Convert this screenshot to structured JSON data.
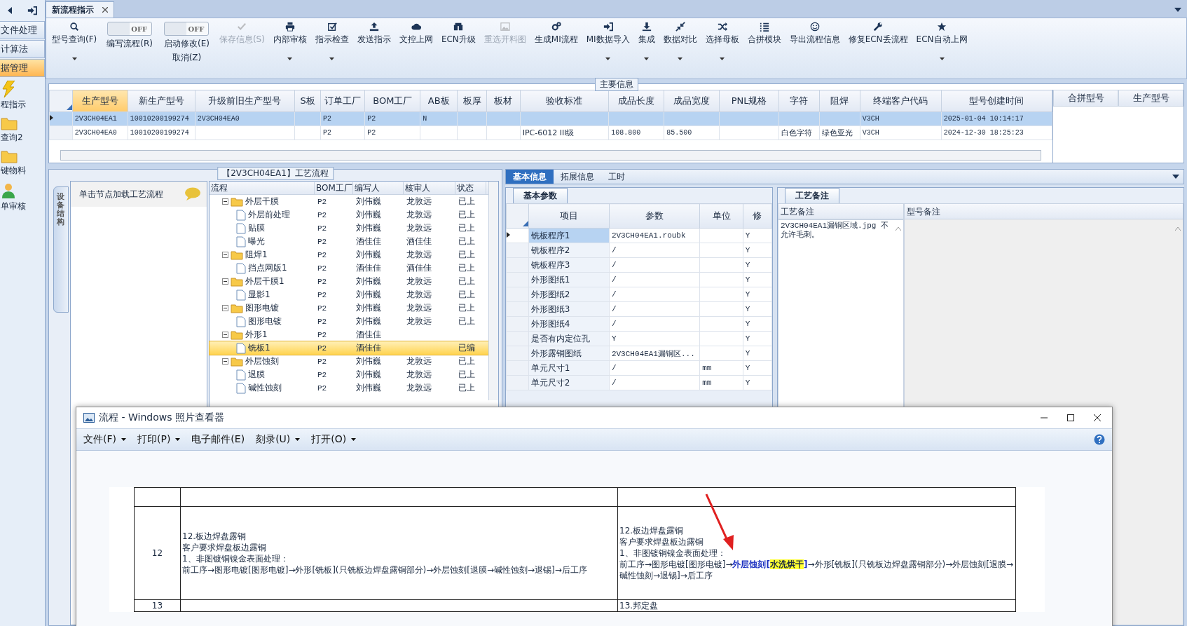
{
  "nav": {
    "items": [
      {
        "label": "文件处理",
        "selected": false
      },
      {
        "label": "计算法",
        "selected": false
      },
      {
        "label": "据管理",
        "selected": true
      }
    ],
    "shortcuts": [
      {
        "label": "程指示"
      },
      {
        "label": "查询2"
      },
      {
        "label": "键物料"
      },
      {
        "label": "单审核"
      }
    ]
  },
  "doc_tab": {
    "label": "新流程指示"
  },
  "ribbon": [
    {
      "kind": "button",
      "label": "型号查询(F)",
      "dropdown": true,
      "disabled": false
    },
    {
      "kind": "toggle",
      "switch_text": "OFF",
      "on": false,
      "lines": [
        "编写流程(R)"
      ]
    },
    {
      "kind": "toggle",
      "switch_text": "OFF",
      "on": false,
      "lines": [
        "启动修改(E)",
        "取消(Z)"
      ]
    },
    {
      "kind": "button",
      "label": "保存信息(S)",
      "dropdown": false,
      "disabled": true
    },
    {
      "kind": "button",
      "label": "内部审核",
      "dropdown": true,
      "disabled": false
    },
    {
      "kind": "button",
      "label": "指示检查",
      "dropdown": true,
      "disabled": false
    },
    {
      "kind": "button",
      "label": "发送指示",
      "dropdown": false,
      "disabled": false
    },
    {
      "kind": "button",
      "label": "文控上网",
      "dropdown": false,
      "disabled": false
    },
    {
      "kind": "button",
      "label": "ECN升级",
      "dropdown": false,
      "disabled": false
    },
    {
      "kind": "button",
      "label": "重选开料图",
      "dropdown": false,
      "disabled": true
    },
    {
      "kind": "button",
      "label": "生成MI流程",
      "dropdown": false,
      "disabled": false
    },
    {
      "kind": "button",
      "label": "MI数据导入",
      "dropdown": true,
      "disabled": false
    },
    {
      "kind": "button",
      "label": "集成",
      "dropdown": true,
      "disabled": false
    },
    {
      "kind": "button",
      "label": "数据对比",
      "dropdown": true,
      "disabled": false
    },
    {
      "kind": "button",
      "label": "选择母板",
      "dropdown": true,
      "disabled": false
    },
    {
      "kind": "button",
      "label": "合拼模块",
      "dropdown": false,
      "disabled": false
    },
    {
      "kind": "button",
      "label": "导出流程信息",
      "dropdown": false,
      "disabled": false
    },
    {
      "kind": "button",
      "label": "修复ECN丢流程",
      "dropdown": false,
      "disabled": false
    },
    {
      "kind": "button",
      "label": "ECN自动上网",
      "dropdown": true,
      "disabled": false
    }
  ],
  "main_info": {
    "legend": "主要信息",
    "columns": [
      "生产型号",
      "新生产型号",
      "升级前旧生产型号",
      "S板",
      "订单工厂",
      "BOM工厂",
      "AB板",
      "板厚",
      "板材",
      "验收标准",
      "成品长度",
      "成品宽度",
      "PNL规格",
      "字符",
      "阻焊",
      "终端客户代码",
      "型号创建时间"
    ],
    "rows": [
      {
        "selected": true,
        "cells": [
          "2V3CH04EA1",
          "10010200199274",
          "2V3CH04EA0",
          null,
          "P2",
          "P2",
          "N",
          null,
          null,
          null,
          null,
          null,
          null,
          null,
          null,
          "V3CH",
          "2025-01-04 10:14:17"
        ]
      },
      {
        "selected": false,
        "cells": [
          "2V3CH04EA0",
          "10010200199274",
          null,
          null,
          "P2",
          "P2",
          null,
          null,
          null,
          "IPC-6012 III级",
          "108.800",
          "85.500",
          null,
          "白色字符",
          "绿色亚光",
          "V3CH",
          "2024-12-30 18:25:23"
        ]
      }
    ],
    "side_columns": [
      "合拼型号",
      "生产型号"
    ]
  },
  "process": {
    "legend": "【2V3CH04EA1】工艺流程",
    "side_tab": "设备结构",
    "hint": "单击节点加载工艺流程",
    "columns": [
      "流程",
      "BOM工厂",
      "编写人",
      "核审人",
      "状态"
    ],
    "tree": [
      {
        "label": "外层干膜",
        "bom": "P2",
        "writer": "刘伟巍",
        "reviewer": "龙敦远",
        "status": "已上",
        "expanded": true,
        "selected": false,
        "children": [
          {
            "label": "外层前处理",
            "bom": "P2",
            "writer": "刘伟巍",
            "reviewer": "龙敦远",
            "status": "已上",
            "selected": false
          },
          {
            "label": "贴膜",
            "bom": "P2",
            "writer": "刘伟巍",
            "reviewer": "龙敦远",
            "status": "已上",
            "selected": false
          },
          {
            "label": "曝光",
            "bom": "P2",
            "writer": "酒佳佳",
            "reviewer": "酒佳佳",
            "status": "已上",
            "selected": false
          }
        ]
      },
      {
        "label": "阻焊1",
        "bom": "P2",
        "writer": "刘伟巍",
        "reviewer": "龙敦远",
        "status": "已上",
        "expanded": true,
        "selected": false,
        "children": [
          {
            "label": "挡点网版1",
            "bom": "P2",
            "writer": "酒佳佳",
            "reviewer": "酒佳佳",
            "status": "已上",
            "selected": false
          }
        ]
      },
      {
        "label": "外层干膜1",
        "bom": "P2",
        "writer": "刘伟巍",
        "reviewer": "龙敦远",
        "status": "已上",
        "expanded": true,
        "selected": false,
        "children": [
          {
            "label": "显影1",
            "bom": "P2",
            "writer": "刘伟巍",
            "reviewer": "龙敦远",
            "status": "已上",
            "selected": false
          }
        ]
      },
      {
        "label": "图形电镀",
        "bom": "P2",
        "writer": "刘伟巍",
        "reviewer": "龙敦远",
        "status": "已上",
        "expanded": true,
        "selected": false,
        "children": [
          {
            "label": "图形电镀",
            "bom": "P2",
            "writer": "刘伟巍",
            "reviewer": "龙敦远",
            "status": "已上",
            "selected": false
          }
        ]
      },
      {
        "label": "外形1",
        "bom": "P2",
        "writer": "酒佳佳",
        "expanded": true,
        "selected": false,
        "children": [
          {
            "label": "铣板1",
            "bom": "P2",
            "writer": "酒佳佳",
            "status": "已编",
            "selected": true
          }
        ]
      },
      {
        "label": "外层蚀刻",
        "bom": "P2",
        "writer": "刘伟巍",
        "reviewer": "龙敦远",
        "status": "已上",
        "expanded": true,
        "selected": false,
        "children": [
          {
            "label": "退膜",
            "bom": "P2",
            "writer": "刘伟巍",
            "reviewer": "龙敦远",
            "status": "已上",
            "selected": false
          },
          {
            "label": "碱性蚀刻",
            "bom": "P2",
            "writer": "刘伟巍",
            "reviewer": "龙敦远",
            "status": "已上",
            "selected": false
          }
        ]
      }
    ]
  },
  "detail": {
    "tabs": [
      {
        "label": "基本信息",
        "selected": true
      },
      {
        "label": "拓展信息",
        "selected": false
      },
      {
        "label": "工时",
        "selected": false
      }
    ],
    "params": {
      "tab": "基本参数",
      "columns": [
        "项目",
        "参数",
        "单位",
        "修"
      ],
      "rows": [
        {
          "selected": true,
          "cells": [
            "铣板程序1",
            "2V3CH04EA1.roubk",
            null,
            "Y"
          ]
        },
        {
          "selected": false,
          "cells": [
            "铣板程序2",
            "/",
            null,
            "Y"
          ]
        },
        {
          "selected": false,
          "cells": [
            "铣板程序3",
            "/",
            null,
            "Y"
          ]
        },
        {
          "selected": false,
          "cells": [
            "外形图纸1",
            "/",
            null,
            "Y"
          ]
        },
        {
          "selected": false,
          "cells": [
            "外形图纸2",
            "/",
            null,
            "Y"
          ]
        },
        {
          "selected": false,
          "cells": [
            "外形图纸3",
            "/",
            null,
            "Y"
          ]
        },
        {
          "selected": false,
          "cells": [
            "外形图纸4",
            "/",
            null,
            "Y"
          ]
        },
        {
          "selected": false,
          "cells": [
            "是否有内定位孔",
            "Y",
            null,
            "Y"
          ]
        },
        {
          "selected": false,
          "cells": [
            "外形露铜图纸",
            "2V3CH04EA1漏铜区...",
            null,
            "Y"
          ]
        },
        {
          "selected": false,
          "cells": [
            "单元尺寸1",
            "/",
            "mm",
            "Y"
          ]
        },
        {
          "selected": false,
          "cells": [
            "单元尺寸2",
            "/",
            "mm",
            "Y"
          ]
        }
      ]
    },
    "notes": {
      "tab": "工艺备注",
      "columns": [
        "工艺备注",
        "型号备注"
      ],
      "text": "2V3CH04EA1漏铜区域.jpg 不允许毛刺。"
    }
  },
  "viewer": {
    "title": "流程 - Windows 照片查看器",
    "menu": [
      {
        "label": "文件(F)",
        "dropdown": true
      },
      {
        "label": "打印(P)",
        "dropdown": true
      },
      {
        "label": "电子邮件(E)",
        "dropdown": false
      },
      {
        "label": "刻录(U)",
        "dropdown": true
      },
      {
        "label": "打开(O)",
        "dropdown": true
      }
    ],
    "document": {
      "rows": [
        {
          "number": "12",
          "left": [
            "12.板边焊盘露铜",
            "客户要求焊盘板边露铜",
            "1、非图镀铜镍金表面处理：",
            "前工序→图形电镀[图形电镀]→外形[铣板](只铣板边焊盘露铜部分)→外层蚀刻[退膜→碱性蚀刻→退锡]→后工序"
          ],
          "right": [
            [
              {
                "kind": "plain",
                "text": "12.板边焊盘露铜"
              }
            ],
            [
              {
                "kind": "plain",
                "text": "客户要求焊盘板边露铜"
              }
            ],
            [
              {
                "kind": "plain",
                "text": "1、非图镀铜镍金表面处理："
              }
            ],
            [
              {
                "kind": "plain",
                "text": "前工序→图形电镀[图形电镀]→"
              },
              {
                "kind": "emphasis",
                "text": "外层蚀刻["
              },
              {
                "kind": "highlight",
                "text": "水洗烘干"
              },
              {
                "kind": "emphasis",
                "text": "]"
              },
              {
                "kind": "plain",
                "text": "→外形[铣板](只铣板边焊盘露铜部分)→外层蚀刻[退膜→碱性蚀刻→退锡]→后工序"
              }
            ]
          ]
        },
        {
          "number": "13",
          "left": [],
          "right": [
            [
              {
                "kind": "plain",
                "text": "13.邦定盘"
              }
            ]
          ]
        }
      ]
    }
  }
}
